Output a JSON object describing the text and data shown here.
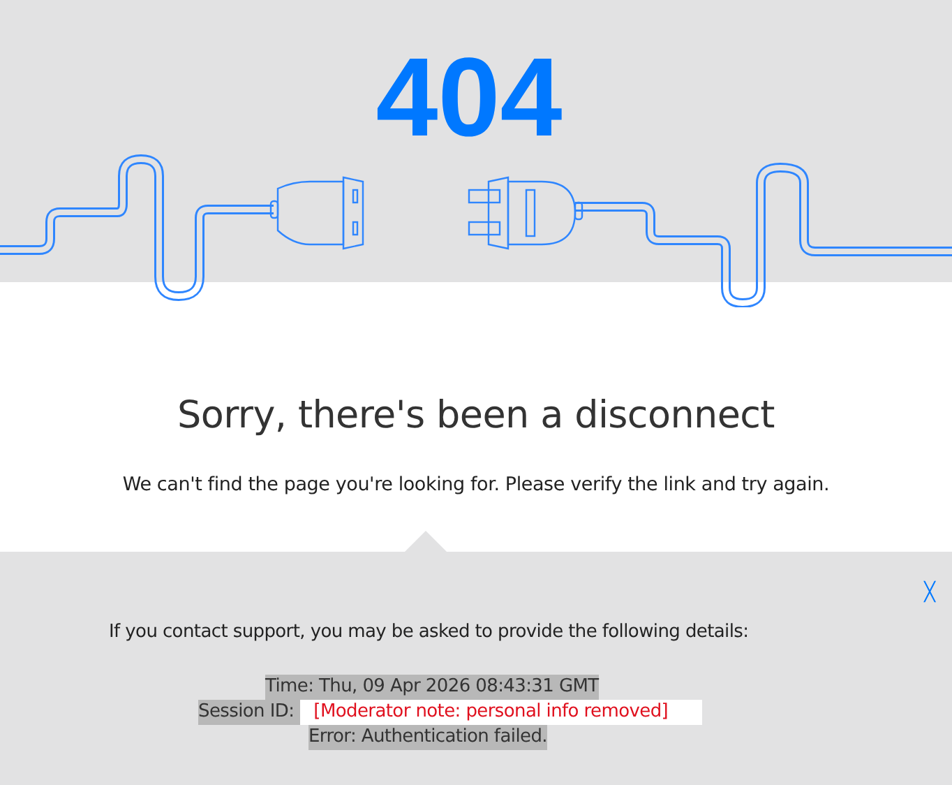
{
  "error_code": "404",
  "heading": "Sorry, there's been a disconnect",
  "message": "We can't find the page you're looking for. Please verify the link and try again.",
  "details": {
    "close_icon": "╳",
    "intro": "If you contact support, you may be asked to provide the following details:",
    "time": "Time: Thu, 09 Apr 2026 08:43:31 GMT",
    "session_label": "Session ID:",
    "session_value": "[Moderator note: personal info removed]",
    "error": "Error: Authentication failed."
  }
}
